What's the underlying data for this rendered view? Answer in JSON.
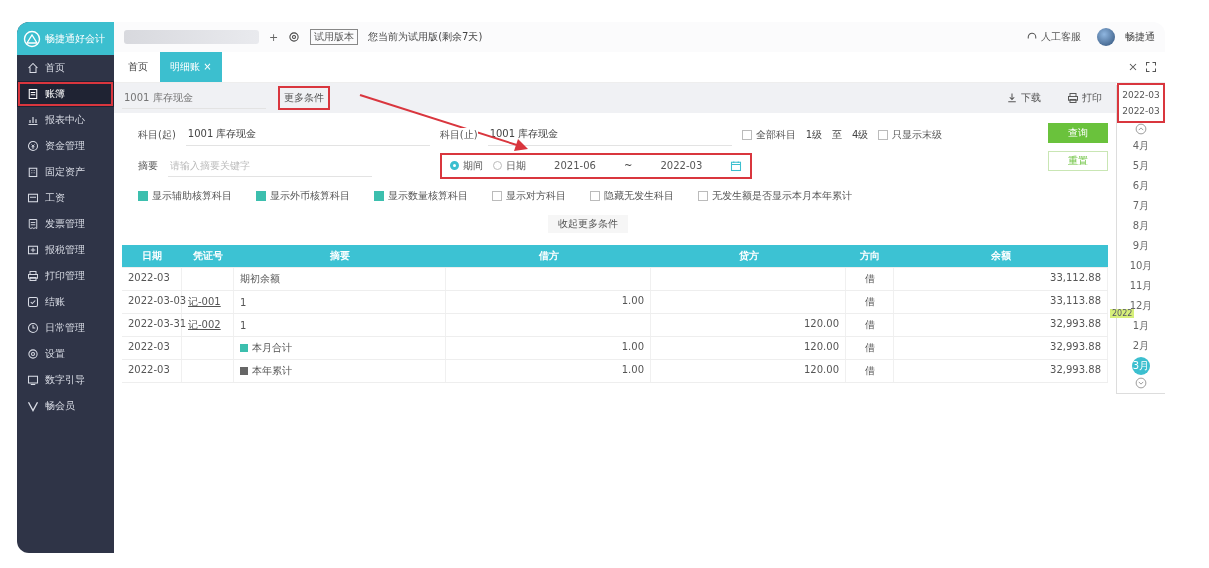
{
  "logo": {
    "text": "畅捷通好会计"
  },
  "sidebar": {
    "items": [
      {
        "label": "首页",
        "selected": false,
        "annotated": false
      },
      {
        "label": "账簿",
        "selected": true,
        "annotated": true
      },
      {
        "label": "报表中心",
        "selected": false,
        "annotated": false
      },
      {
        "label": "资金管理",
        "selected": false,
        "annotated": false
      },
      {
        "label": "固定资产",
        "selected": false,
        "annotated": false
      },
      {
        "label": "工资",
        "selected": false,
        "annotated": false
      },
      {
        "label": "发票管理",
        "selected": false,
        "annotated": false
      },
      {
        "label": "报税管理",
        "selected": false,
        "annotated": false
      },
      {
        "label": "打印管理",
        "selected": false,
        "annotated": false
      },
      {
        "label": "结账",
        "selected": false,
        "annotated": false
      },
      {
        "label": "日常管理",
        "selected": false,
        "annotated": false
      },
      {
        "label": "设置",
        "selected": false,
        "annotated": false
      },
      {
        "label": "数字引导",
        "selected": false,
        "annotated": false
      },
      {
        "label": "畅会员",
        "selected": false,
        "annotated": false
      }
    ]
  },
  "topbar": {
    "add": "+",
    "version_tag": "试用版本",
    "notice": "您当前为试用版(剩余7天)",
    "service": "人工客服",
    "user": "畅捷通"
  },
  "tabs": [
    {
      "label": "首页",
      "selected": false
    },
    {
      "label": "明细账",
      "selected": true,
      "close": "×"
    }
  ],
  "toolbar": {
    "subject_placeholder": "1001 库存现金",
    "more_link": "更多条件",
    "more_annotated": true,
    "actions": [
      {
        "label": "下载",
        "kind": "download"
      },
      {
        "label": "打印",
        "kind": "print"
      }
    ]
  },
  "filter": {
    "from_label": "科目(起)",
    "from_value": "1001 库存现金",
    "to_label": "科目(止)",
    "to_value": "1001 库存现金",
    "all_subjects": {
      "label": "全部科目",
      "checked": false
    },
    "level_from": "1级",
    "level_sep": "至",
    "level_to": "4级",
    "leaf_only": {
      "label": "只显示末级",
      "checked": false
    },
    "summary_label": "摘要",
    "summary_placeholder": "请输入摘要关键字",
    "date_mode": [
      {
        "label": "期间",
        "selected": true
      },
      {
        "label": "日期",
        "selected": false
      }
    ],
    "date_from": "2021-06",
    "date_sep": "~",
    "date_to": "2022-03",
    "date_annotated": true,
    "options": [
      {
        "label": "显示辅助核算科目",
        "checked": true
      },
      {
        "label": "显示外币核算科目",
        "checked": true
      },
      {
        "label": "显示数量核算科目",
        "checked": true
      },
      {
        "label": "显示对方科目",
        "checked": false
      },
      {
        "label": "隐藏无发生科目",
        "checked": false
      },
      {
        "label": "无发生额是否显示本月本年累计",
        "checked": false
      }
    ],
    "query_button": "查询",
    "reset_button": "重置",
    "collapse_link": "收起更多条件"
  },
  "table": {
    "columns": [
      "日期",
      "凭证号",
      "摘要",
      "借方",
      "贷方",
      "方向",
      "余额"
    ],
    "rows": [
      {
        "kind": "entry",
        "date": "2022-03",
        "voucher": "",
        "summary": "期初余额",
        "debit": "",
        "credit": "",
        "direction": "借",
        "balance": "33,112.88"
      },
      {
        "kind": "entry",
        "date": "2022-03-03",
        "voucher": "记-001",
        "summary": "1",
        "debit": "1.00",
        "credit": "",
        "direction": "借",
        "balance": "33,113.88"
      },
      {
        "kind": "entry",
        "date": "2022-03-31",
        "voucher": "记-002",
        "summary": "1",
        "debit": "",
        "credit": "120.00",
        "direction": "借",
        "balance": "32,993.88"
      },
      {
        "kind": "month_total",
        "date": "2022-03",
        "voucher": "",
        "summary": "本月合计",
        "debit": "1.00",
        "credit": "120.00",
        "direction": "借",
        "balance": "32,993.88"
      },
      {
        "kind": "year_total",
        "date": "2022-03",
        "voucher": "",
        "summary": "本年累计",
        "debit": "1.00",
        "credit": "120.00",
        "direction": "借",
        "balance": "32,993.88"
      }
    ]
  },
  "period_strip": {
    "header": [
      "2022-03",
      "2022-03"
    ],
    "header_annotated": true,
    "months": [
      {
        "label": "4月",
        "selected": false
      },
      {
        "label": "5月",
        "selected": false
      },
      {
        "label": "6月",
        "selected": false
      },
      {
        "label": "7月",
        "selected": false
      },
      {
        "label": "8月",
        "selected": false
      },
      {
        "label": "9月",
        "selected": false
      },
      {
        "label": "10月",
        "selected": false
      },
      {
        "label": "11月",
        "selected": false
      },
      {
        "label": "12月",
        "selected": false
      },
      {
        "label": "1月",
        "selected": false,
        "year_tag": "2022"
      },
      {
        "label": "2月",
        "selected": false
      },
      {
        "label": "3月",
        "selected": true
      }
    ]
  }
}
